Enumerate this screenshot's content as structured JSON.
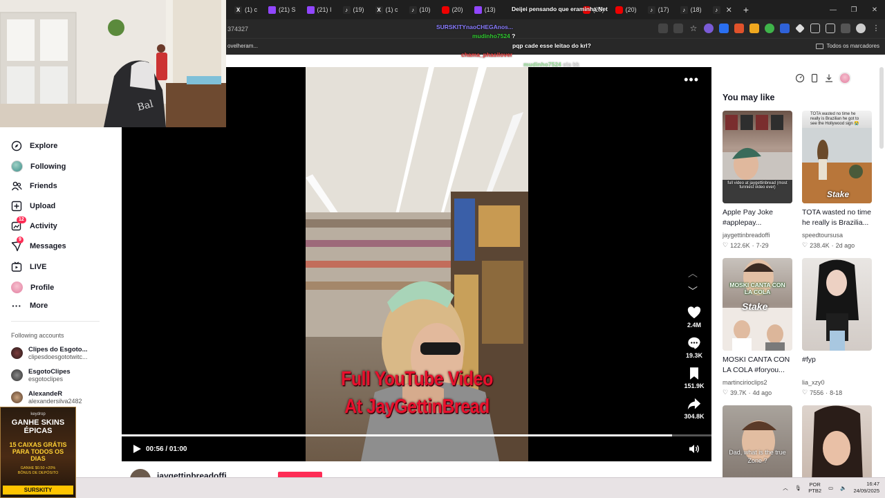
{
  "browser": {
    "tabs": [
      {
        "icon": "x-icon",
        "label": "(1) c"
      },
      {
        "icon": "twitch-icon",
        "label": "(21) S"
      },
      {
        "icon": "twitch-icon",
        "label": "(21) I"
      },
      {
        "icon": "tiktok-icon",
        "label": "(19)"
      },
      {
        "icon": "x-icon",
        "label": "(1) c"
      },
      {
        "icon": "tiktok-icon",
        "label": "(10)"
      },
      {
        "icon": "youtube-icon",
        "label": "(20)"
      },
      {
        "icon": "twitch-icon",
        "label": "(13)"
      },
      {
        "icon": "youtube-icon",
        "label": "(20)"
      },
      {
        "icon": "youtube-icon",
        "label": "(20)"
      },
      {
        "icon": "tiktok-icon",
        "label": "(17)"
      },
      {
        "icon": "tiktok-icon",
        "label": "(18)"
      }
    ],
    "url_fragment": "374327",
    "bookmark_left": "ovelheram...",
    "bookmark_right": "Todos os marcadores"
  },
  "chat": [
    {
      "user": "",
      "text": "Deijei pensando que eraminha Net",
      "color": "#ffffff"
    },
    {
      "user": "SURSKITYnaoCHEGAnos...",
      "text": "",
      "color": "#8a7dff"
    },
    {
      "user": "mudinho7524",
      "text": "?",
      "color": "#33cc33"
    },
    {
      "user": "",
      "text": "pqp cade esse leitao do krl?",
      "color": "#ffffff"
    },
    {
      "user": "chama_phasilover",
      "text": "",
      "color": "#ff4444"
    },
    {
      "user": "mudinho7524",
      "text": "ela kk",
      "color": "#33cc33"
    }
  ],
  "sidebar": {
    "items": [
      {
        "label": "Explore",
        "icon": "compass-icon"
      },
      {
        "label": "Following",
        "icon": "following-avatar-icon"
      },
      {
        "label": "Friends",
        "icon": "friends-icon"
      },
      {
        "label": "Upload",
        "icon": "upload-icon"
      },
      {
        "label": "Activity",
        "icon": "activity-icon",
        "badge": "12"
      },
      {
        "label": "Messages",
        "icon": "messages-icon",
        "badge": "9"
      },
      {
        "label": "LIVE",
        "icon": "live-icon"
      },
      {
        "label": "Profile",
        "icon": "profile-avatar-icon"
      },
      {
        "label": "More",
        "icon": "more-icon"
      }
    ],
    "following_title": "Following accounts",
    "following": [
      {
        "name": "Clipes do Esgoto...",
        "handle": "clipesdoesgototwitc..."
      },
      {
        "name": "EsgotoClipes",
        "handle": "esgotoclipes"
      },
      {
        "name": "AlexandeR",
        "handle": "alexandersilva2482"
      }
    ]
  },
  "ad": {
    "brand": "keydrop",
    "headline": "GANHE SKINS ÉPICAS",
    "offer": "15 CAIXAS GRÁTIS PARA TODOS OS DIAS",
    "bonus": "GANHE $0.50 +20% BÔNUS DE DEPÓSITO",
    "footer": "SURSKITY"
  },
  "video": {
    "caption_line1": "Full YouTube Video",
    "caption_line2": "At JayGettinBread",
    "likes": "2.4M",
    "comments": "19.3K",
    "saves": "151.9K",
    "shares": "304.8K",
    "time": "00:56 / 01:00",
    "progress": 0.933,
    "author": "jaygettinbreadoffi"
  },
  "right_panel": {
    "title": "You may like",
    "cards": [
      {
        "title": "Apple Pay Joke #applepay...",
        "author": "jaygettinbreadoffi",
        "likes": "122.6K",
        "age": "7-29",
        "thumb_text": "full video at jaygettinbread (most funniest video ever)"
      },
      {
        "title": "TOTA wasted no time he really is Brazilia...",
        "author": "speedtoursusa",
        "likes": "238.4K",
        "age": "2d ago",
        "thumb_text": "TOTA wasted no time he really is Brazilian he got to see the Hollywood sign 😭"
      },
      {
        "title": "MOSKI CANTA CON LA COLA #foryou...",
        "author": "martincirioclips2",
        "likes": "39.7K",
        "age": "4d ago",
        "thumb_text": "MOSKI CANTA CON LA COLA"
      },
      {
        "title": "#fyp",
        "author": "lia_xzy0",
        "likes": "7556",
        "age": "8-18",
        "thumb_text": ""
      },
      {
        "title": "",
        "author": "",
        "likes": "",
        "age": "",
        "thumb_text": "Dad, what is the true Zone ?"
      },
      {
        "title": "",
        "author": "",
        "likes": "",
        "age": "",
        "thumb_text": ""
      }
    ],
    "stake": "Stake"
  },
  "taskbar": {
    "lang_top": "POR",
    "lang_bottom": "PTB2",
    "time": "16:47",
    "date": "24/09/2025"
  }
}
